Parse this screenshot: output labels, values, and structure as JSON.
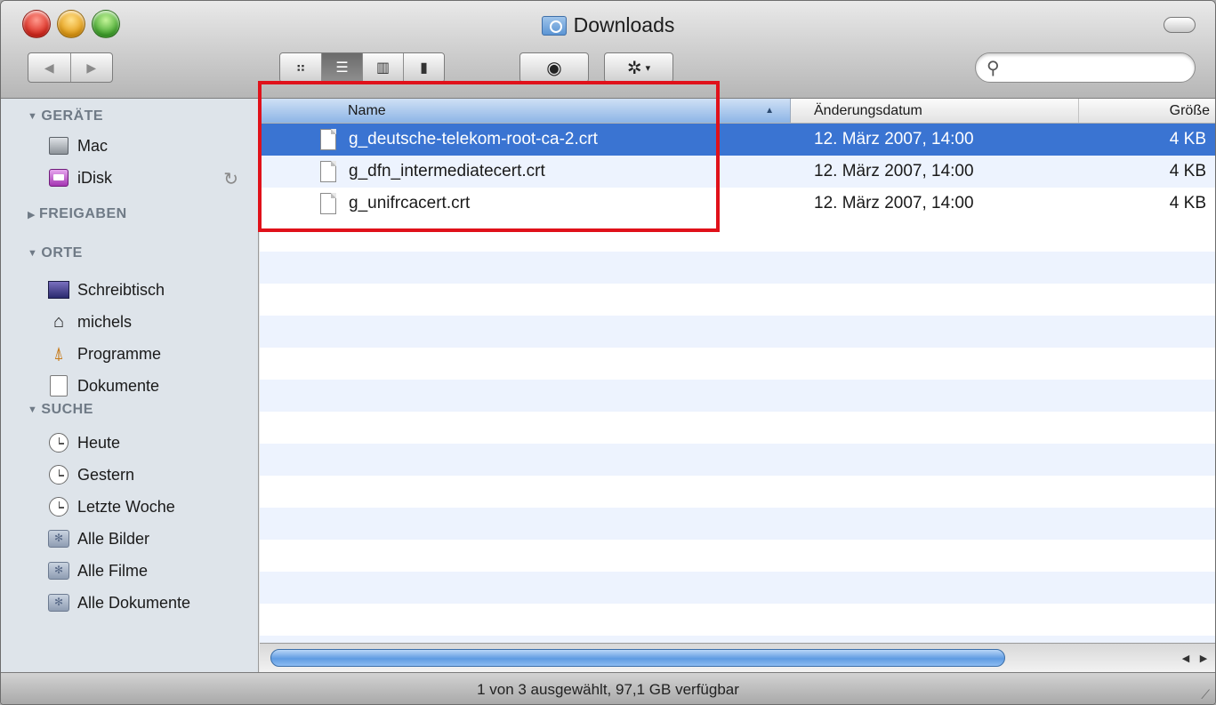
{
  "window": {
    "title": "Downloads"
  },
  "toolbar": {
    "back_glyph": "◀",
    "forward_glyph": "▶",
    "views": [
      {
        "name": "icon-view",
        "glyph": "⠶"
      },
      {
        "name": "list-view",
        "glyph": "☰"
      },
      {
        "name": "column-view",
        "glyph": "▥"
      },
      {
        "name": "coverflow-view",
        "glyph": "▮"
      }
    ],
    "active_view": "list-view",
    "eye_glyph": "◉",
    "gear_glyph": "✲",
    "gear_caret": "▾",
    "search": {
      "value": "",
      "placeholder": ""
    },
    "search_glyph": "⚲"
  },
  "sidebar": {
    "sections": [
      {
        "name": "GERÄTE",
        "expanded": true,
        "items": [
          {
            "label": "Mac",
            "icon": "mac-icon"
          },
          {
            "label": "iDisk",
            "icon": "idisk-icon"
          }
        ]
      },
      {
        "name": "FREIGABEN",
        "expanded": false,
        "items": []
      },
      {
        "name": "ORTE",
        "expanded": true,
        "items": [
          {
            "label": "Schreibtisch",
            "icon": "desktop-icon"
          },
          {
            "label": "michels",
            "icon": "home-icon"
          },
          {
            "label": "Programme",
            "icon": "applications-icon"
          },
          {
            "label": "Dokumente",
            "icon": "documents-icon"
          }
        ]
      },
      {
        "name": "SUCHE",
        "expanded": true,
        "items": [
          {
            "label": "Heute",
            "icon": "clock-icon"
          },
          {
            "label": "Gestern",
            "icon": "clock-icon"
          },
          {
            "label": "Letzte Woche",
            "icon": "clock-icon"
          },
          {
            "label": "Alle Bilder",
            "icon": "smart-folder-icon"
          },
          {
            "label": "Alle Filme",
            "icon": "smart-folder-icon"
          },
          {
            "label": "Alle Dokumente",
            "icon": "smart-folder-icon"
          }
        ]
      }
    ],
    "expanded_glyph": "▼",
    "collapsed_glyph": "▶"
  },
  "columns": {
    "name": "Name",
    "date": "Änderungsdatum",
    "size": "Größe",
    "sort_glyph": "▲"
  },
  "files": [
    {
      "name": "g_deutsche-telekom-root-ca-2.crt",
      "date": "12. März 2007, 14:00",
      "size": "4 KB",
      "selected": true
    },
    {
      "name": "g_dfn_intermediatecert.crt",
      "date": "12. März 2007, 14:00",
      "size": "4 KB",
      "selected": false
    },
    {
      "name": "g_unifrcacert.crt",
      "date": "12. März 2007, 14:00",
      "size": "4 KB",
      "selected": false
    }
  ],
  "scrollbar": {
    "left_glyph": "◀",
    "right_glyph": "▶"
  },
  "status": {
    "text": "1 von 3 ausgewählt, 97,1 GB verfügbar"
  },
  "colors": {
    "selection": "#3a74d2",
    "highlight_frame": "#e0111a"
  }
}
